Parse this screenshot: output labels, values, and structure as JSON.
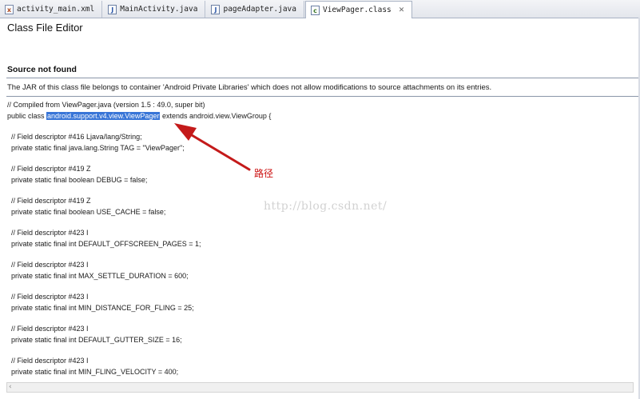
{
  "tabs": [
    {
      "label": "activity_main.xml",
      "icon": "xml-file-icon",
      "active": false
    },
    {
      "label": "MainActivity.java",
      "icon": "java-file-icon",
      "active": false
    },
    {
      "label": "pageAdapter.java",
      "icon": "java-file-icon",
      "active": false
    },
    {
      "label": "ViewPager.class",
      "icon": "class-file-icon",
      "active": true,
      "close": "✕"
    }
  ],
  "editor": {
    "title": "Class File Editor",
    "section_title": "Source not found",
    "notice": "The JAR of this class file belongs to container 'Android Private Libraries' which does not allow modifications to source attachments on its entries."
  },
  "code": {
    "compiled_line": "// Compiled from ViewPager.java (version 1.5 : 49.0, super bit)",
    "class_prefix": "public class ",
    "class_name": "android.support.v4.view.ViewPager",
    "class_suffix": " extends android.view.ViewGroup {",
    "fields": [
      {
        "comment": "  // Field descriptor #416 Ljava/lang/String;",
        "decl": "  private static final java.lang.String TAG = \"ViewPager\";"
      },
      {
        "comment": "  // Field descriptor #419 Z",
        "decl": "  private static final boolean DEBUG = false;"
      },
      {
        "comment": "  // Field descriptor #419 Z",
        "decl": "  private static final boolean USE_CACHE = false;"
      },
      {
        "comment": "  // Field descriptor #423 I",
        "decl": "  private static final int DEFAULT_OFFSCREEN_PAGES = 1;"
      },
      {
        "comment": "  // Field descriptor #423 I",
        "decl": "  private static final int MAX_SETTLE_DURATION = 600;"
      },
      {
        "comment": "  // Field descriptor #423 I",
        "decl": "  private static final int MIN_DISTANCE_FOR_FLING = 25;"
      },
      {
        "comment": "  // Field descriptor #423 I",
        "decl": "  private static final int DEFAULT_GUTTER_SIZE = 16;"
      },
      {
        "comment": "  // Field descriptor #423 I",
        "decl": "  private static final int MIN_FLING_VELOCITY = 400;"
      }
    ]
  },
  "annotation": {
    "text": "路径",
    "color": "#cc1111"
  },
  "watermark": "http://blog.csdn.net/",
  "scrollbar": {
    "left_arrow": "‹"
  },
  "colors": {
    "selection": "#3875d7",
    "annotation_arrow": "#c41a1a"
  }
}
